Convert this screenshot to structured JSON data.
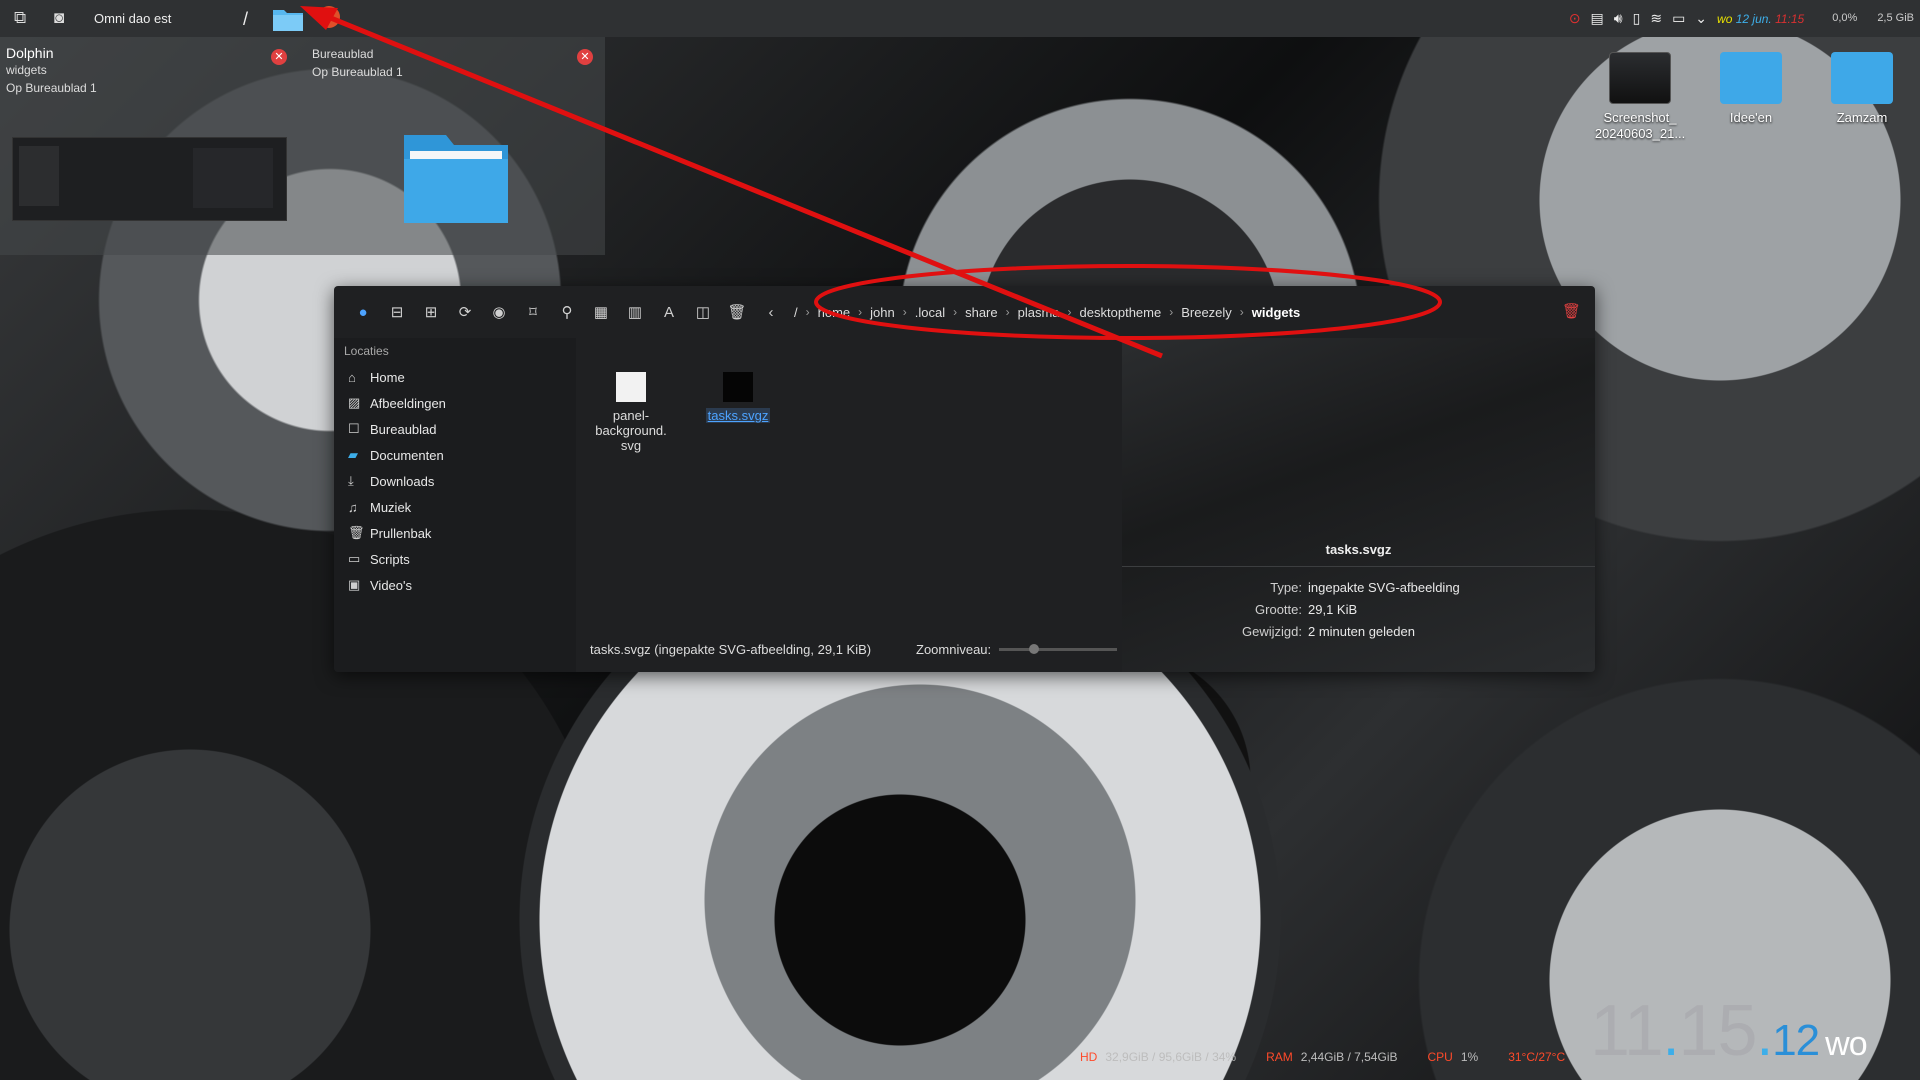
{
  "topbar": {
    "window_title": "Omni dao est",
    "slash": "/",
    "tray": {
      "clock_day": "wo",
      "clock_date": "12 jun.",
      "clock_time": "11:15",
      "cpu": "0,0%",
      "mem": "2,5 GiB"
    }
  },
  "previews": [
    {
      "title": "Dolphin",
      "subtitle": "widgets",
      "desktop": "Op Bureaublad 1"
    },
    {
      "title": "",
      "subtitle": "Bureaublad",
      "desktop": "Op Bureaublad 1"
    }
  ],
  "dolphin": {
    "breadcrumb": [
      "/",
      "home",
      "john",
      ".local",
      "share",
      "plasma",
      "desktoptheme",
      "Breezely",
      "widgets"
    ],
    "sidebar_heading": "Locaties",
    "places": [
      {
        "label": "Home",
        "icon": "home-icon"
      },
      {
        "label": "Afbeeldingen",
        "icon": "image-icon"
      },
      {
        "label": "Bureaublad",
        "icon": "desktop-icon"
      },
      {
        "label": "Documenten",
        "icon": "folder-icon"
      },
      {
        "label": "Downloads",
        "icon": "download-icon"
      },
      {
        "label": "Muziek",
        "icon": "music-icon"
      },
      {
        "label": "Prullenbak",
        "icon": "trash-icon"
      },
      {
        "label": "Scripts",
        "icon": "folder-icon"
      },
      {
        "label": "Video's",
        "icon": "video-icon"
      }
    ],
    "files": [
      {
        "name_line1": "panel-background.",
        "name_line2": "svg"
      },
      {
        "name": "tasks.svgz",
        "selected": true
      }
    ],
    "status": "tasks.svgz (ingepakte SVG-afbeelding, 29,1 KiB)",
    "zoom_label": "Zoomniveau:",
    "info": {
      "name": "tasks.svgz",
      "rows": [
        {
          "key": "Type:",
          "value": "ingepakte SVG-afbeelding"
        },
        {
          "key": "Grootte:",
          "value": "29,1 KiB"
        },
        {
          "key": "Gewijzigd:",
          "value": "2 minuten geleden"
        }
      ]
    }
  },
  "desktop_icons": [
    {
      "line1": "Screenshot_",
      "line2": "20240603_21..."
    },
    {
      "line1": "Idee'en",
      "line2": ""
    },
    {
      "line1": "Zamzam",
      "line2": ""
    }
  ],
  "sysinfo": {
    "hd_label": "HD",
    "hd_value": "32,9GiB / 95,6GiB / 34%",
    "ram_label": "RAM",
    "ram_value": "2,44GiB / 7,54GiB",
    "cpu_label": "CPU",
    "cpu_value": "1%",
    "temp": "31°C/27°C"
  },
  "bigclock": {
    "hours": "11",
    "minutes": "15",
    "seconds": "12",
    "day": "wo"
  },
  "colors": {
    "accent": "#3daee9",
    "annotation": "#e01010",
    "alert": "#ff4a2a"
  }
}
